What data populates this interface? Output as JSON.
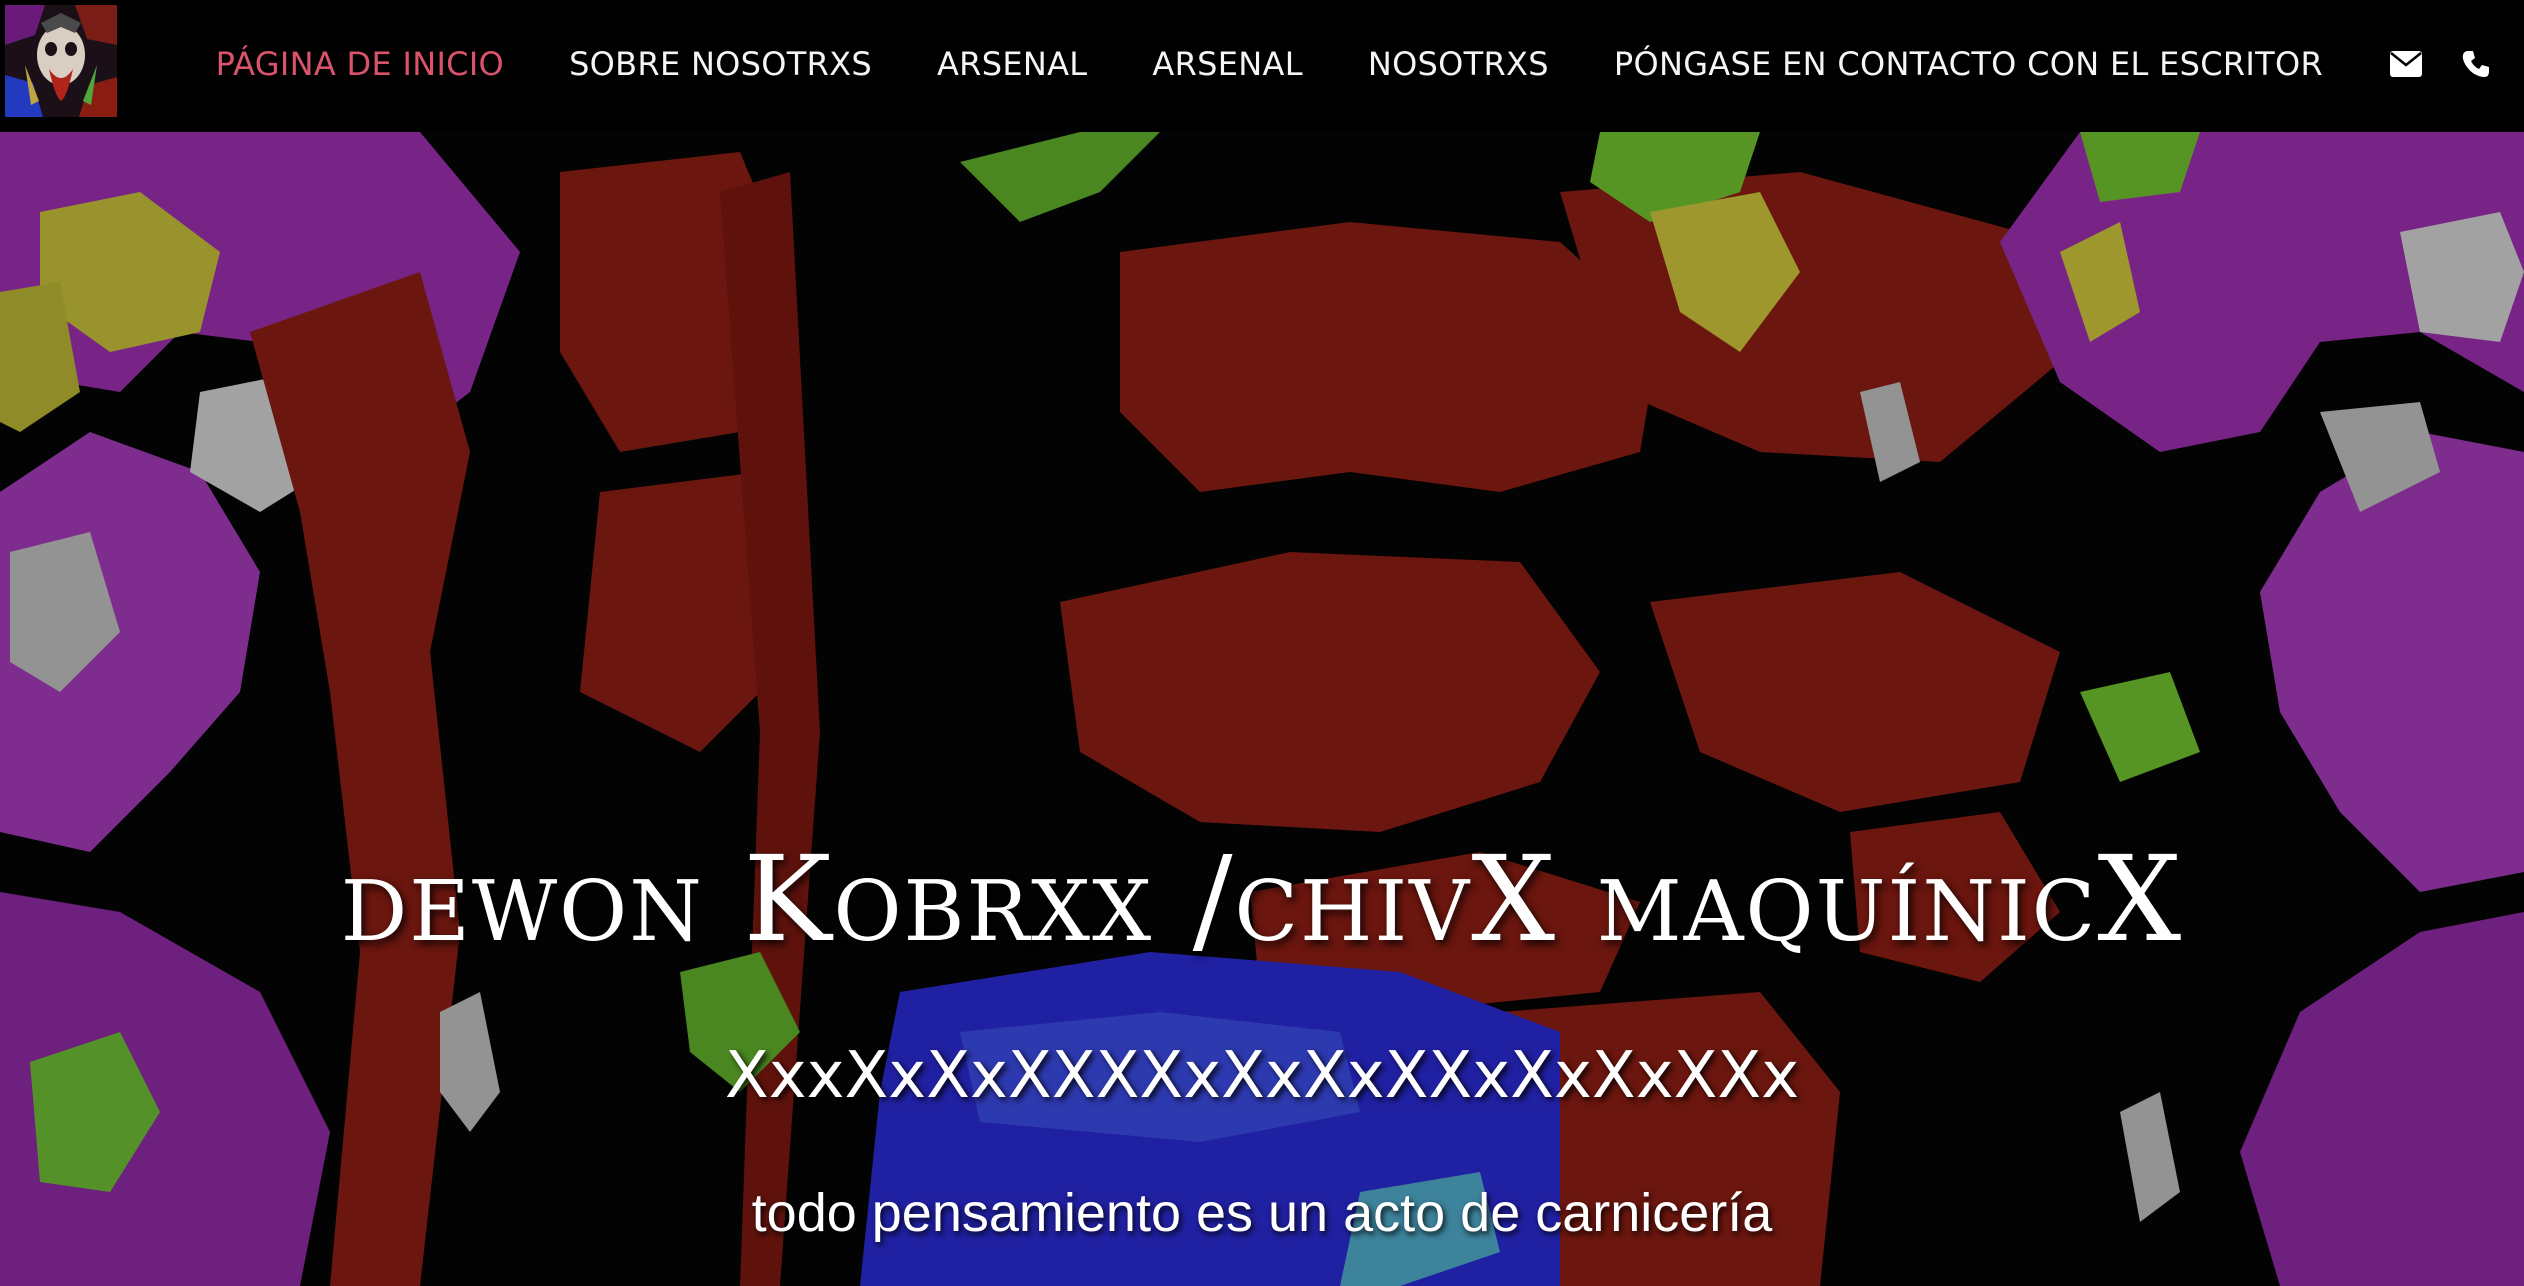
{
  "header": {
    "logo_icon": "artwork-logo-thumbnail",
    "nav": [
      {
        "label": "PÁGINA DE INICIO",
        "active": true
      },
      {
        "label": "SOBRE NOSOTRXS",
        "active": false
      },
      {
        "label": "ARSENAL",
        "active": false
      },
      {
        "label": "ARSENAL",
        "active": false
      },
      {
        "label": "NOSOTRXS",
        "active": false
      },
      {
        "label": "PÓNGASE EN CONTACTO CON EL ESCRITOR",
        "active": false
      }
    ],
    "icons": [
      "envelope-icon",
      "phone-icon"
    ],
    "active_color": "#d9536b",
    "text_color": "#f5f5f5",
    "background": "#000000"
  },
  "hero": {
    "title": "dewon Kobrxx /chivX maquínicX",
    "subtitle": "XxxXxXxXXXXxXxXxXXxXxXxXXx",
    "tagline": "todo pensamiento es un acto de carnicería",
    "palette": [
      "#8a1d12",
      "#a63ab8",
      "#2a2ad0",
      "#6fbf2e",
      "#c9c23a",
      "#000000"
    ]
  }
}
